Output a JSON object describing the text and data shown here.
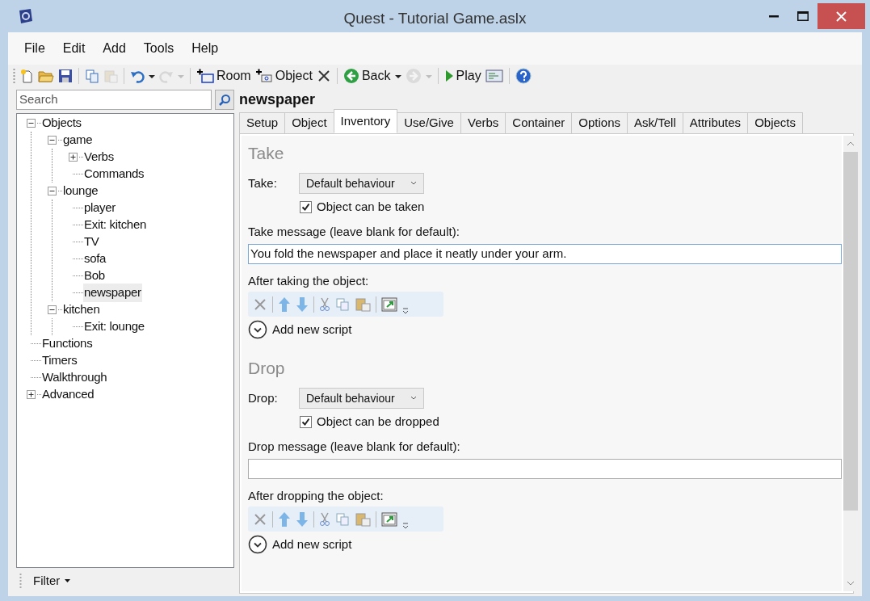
{
  "window": {
    "title": "Quest - Tutorial Game.aslx"
  },
  "menu": [
    "File",
    "Edit",
    "Add",
    "Tools",
    "Help"
  ],
  "toolbar": [
    {
      "kind": "new",
      "disabled": false
    },
    {
      "kind": "open",
      "disabled": false
    },
    {
      "kind": "save",
      "disabled": false
    },
    {
      "kind": "sep"
    },
    {
      "kind": "copy",
      "disabled": false
    },
    {
      "kind": "paste",
      "disabled": true
    },
    {
      "kind": "sep"
    },
    {
      "kind": "undo",
      "disabled": false
    },
    {
      "kind": "drop",
      "disabled": false
    },
    {
      "kind": "redo",
      "disabled": true
    },
    {
      "kind": "drop",
      "disabled": true
    },
    {
      "kind": "sep"
    },
    {
      "kind": "add-room",
      "label": "Room",
      "disabled": false
    },
    {
      "kind": "add-object",
      "label": "Object",
      "disabled": false
    },
    {
      "kind": "delete",
      "disabled": false
    },
    {
      "kind": "sep"
    },
    {
      "kind": "back",
      "label": "Back",
      "disabled": false
    },
    {
      "kind": "drop",
      "disabled": false
    },
    {
      "kind": "forward",
      "disabled": true
    },
    {
      "kind": "drop",
      "disabled": true
    },
    {
      "kind": "sep"
    },
    {
      "kind": "play",
      "label": "Play",
      "disabled": false
    },
    {
      "kind": "code",
      "disabled": false
    },
    {
      "kind": "sep"
    },
    {
      "kind": "help",
      "disabled": false
    }
  ],
  "search": {
    "placeholder": "Search"
  },
  "tree": [
    {
      "label": "Objects",
      "expanded": true,
      "selected": false,
      "children": [
        {
          "label": "game",
          "expanded": true,
          "selected": false,
          "children": [
            {
              "label": "Verbs",
              "expanded": false,
              "selected": false
            },
            {
              "label": "Commands",
              "selected": false
            }
          ]
        },
        {
          "label": "lounge",
          "expanded": true,
          "selected": false,
          "children": [
            {
              "label": "player",
              "selected": false
            },
            {
              "label": "Exit: kitchen",
              "selected": false
            },
            {
              "label": "TV",
              "selected": false
            },
            {
              "label": "sofa",
              "selected": false
            },
            {
              "label": "Bob",
              "selected": false
            },
            {
              "label": "newspaper",
              "selected": true
            }
          ]
        },
        {
          "label": "kitchen",
          "expanded": true,
          "selected": false,
          "children": [
            {
              "label": "Exit: lounge",
              "selected": false
            }
          ]
        }
      ]
    },
    {
      "label": "Functions",
      "selected": false
    },
    {
      "label": "Timers",
      "selected": false
    },
    {
      "label": "Walkthrough",
      "selected": false
    },
    {
      "label": "Advanced",
      "expanded": false,
      "selected": false
    }
  ],
  "filter": "Filter",
  "object_name": "newspaper",
  "tabs": [
    {
      "label": "Setup",
      "selected": false
    },
    {
      "label": "Object",
      "selected": false
    },
    {
      "label": "Inventory",
      "selected": true
    },
    {
      "label": "Use/Give",
      "selected": false
    },
    {
      "label": "Verbs",
      "selected": false
    },
    {
      "label": "Container",
      "selected": false
    },
    {
      "label": "Options",
      "selected": false
    },
    {
      "label": "Ask/Tell",
      "selected": false
    },
    {
      "label": "Attributes",
      "selected": false
    },
    {
      "label": "Objects",
      "selected": false
    }
  ],
  "sections": [
    {
      "title": "Take",
      "field_label": "Take:",
      "dropdown": "Default behaviour",
      "checkbox": {
        "label": "Object can be taken",
        "checked": true
      },
      "message_label": "Take message (leave blank for default):",
      "message": "You fold the newspaper and place it neatly under your arm.",
      "script_label": "After taking the object:",
      "add_script": "Add new script"
    },
    {
      "title": "Drop",
      "field_label": "Drop:",
      "dropdown": "Default behaviour",
      "checkbox": {
        "label": "Object can be dropped",
        "checked": true
      },
      "message_label": "Drop message (leave blank for default):",
      "script_label": "After dropping the object:",
      "add_script": "Add new script"
    }
  ]
}
